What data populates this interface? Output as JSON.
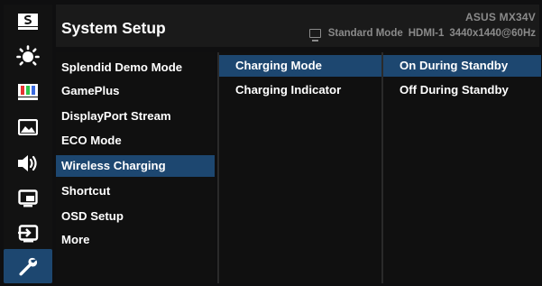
{
  "header": {
    "title": "System Setup",
    "model": "ASUS  MX34V",
    "mode": "Standard Mode",
    "input": "HDMI-1",
    "resolution": "3440x1440@60Hz"
  },
  "rail": [
    {
      "icon": "splendid-s-icon",
      "active": false
    },
    {
      "icon": "bluelight-filter-icon",
      "active": false
    },
    {
      "icon": "color-bars-icon",
      "active": false
    },
    {
      "icon": "image-icon",
      "active": false
    },
    {
      "icon": "speaker-icon",
      "active": false
    },
    {
      "icon": "pip-icon",
      "active": false
    },
    {
      "icon": "input-select-icon",
      "active": false
    },
    {
      "icon": "wrench-icon",
      "active": true
    }
  ],
  "menu": {
    "items": [
      "Splendid Demo Mode",
      "GamePlus",
      "DisplayPort Stream",
      "ECO Mode",
      "Wireless Charging",
      "Shortcut",
      "OSD Setup",
      "More"
    ],
    "selected_index": 4
  },
  "submenu": {
    "items": [
      "Charging Mode",
      "Charging Indicator"
    ],
    "selected_index": 0
  },
  "options": {
    "items": [
      "On During Standby",
      "Off During Standby"
    ],
    "selected_index": 0
  },
  "colors": {
    "highlight": "#1d4770",
    "background": "#101010",
    "header": "#1a1a1a",
    "muted_text": "#8a8a8a"
  }
}
